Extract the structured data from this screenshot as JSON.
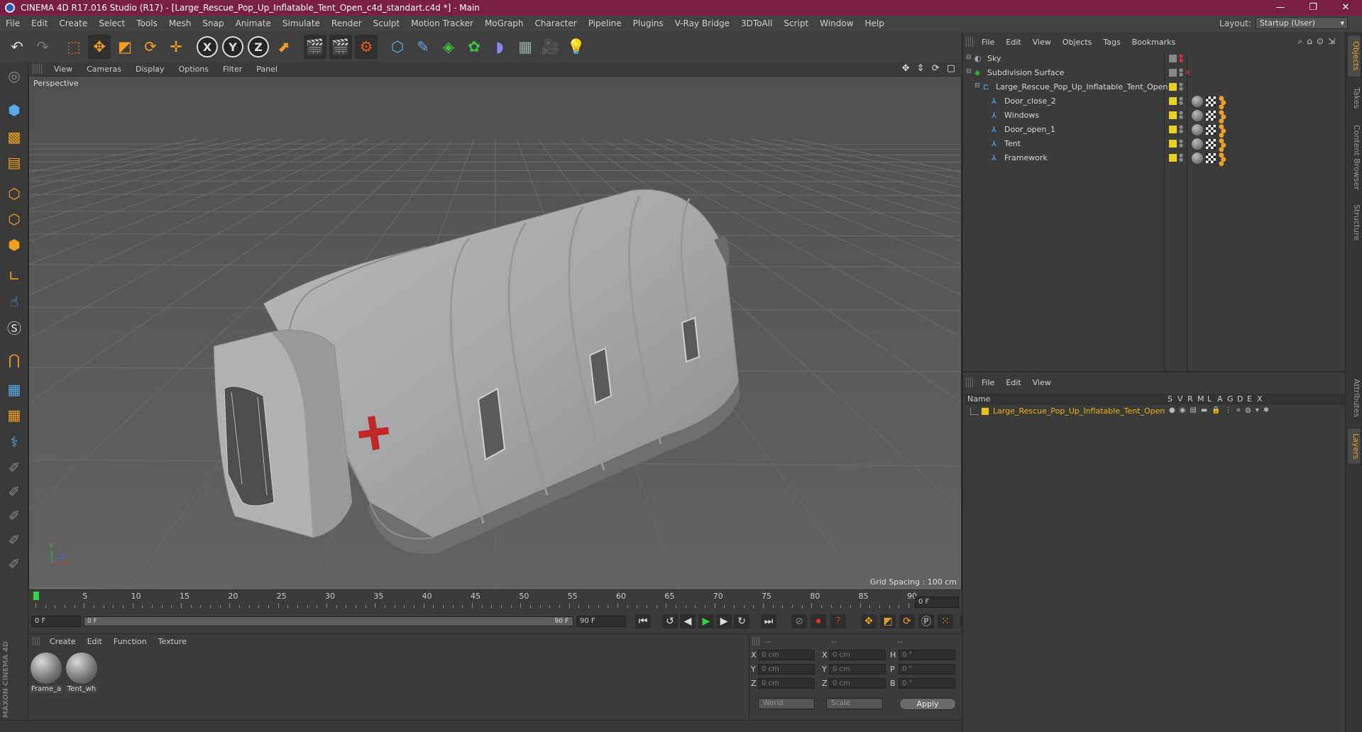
{
  "window": {
    "title": "CINEMA 4D R17.016 Studio (R17) - [Large_Rescue_Pop_Up_Inflatable_Tent_Open_c4d_standart.c4d *] - Main",
    "controls": [
      "—",
      "❐",
      "✕"
    ]
  },
  "menubar": {
    "items": [
      "File",
      "Edit",
      "Create",
      "Select",
      "Tools",
      "Mesh",
      "Snap",
      "Animate",
      "Simulate",
      "Render",
      "Sculpt",
      "Motion Tracker",
      "MoGraph",
      "Character",
      "Pipeline",
      "Plugins",
      "V-Ray Bridge",
      "3DToAll",
      "Script",
      "Window",
      "Help"
    ],
    "layout_label": "Layout:",
    "layout_value": "Startup (User)"
  },
  "viewport": {
    "menu": [
      "View",
      "Cameras",
      "Display",
      "Options",
      "Filter",
      "Panel"
    ],
    "controls": "✥ ⇕ ⟳ ▢",
    "label": "Perspective",
    "grid_spacing": "Grid Spacing : 100 cm",
    "axis_labels": [
      "Y",
      "Z",
      "X"
    ]
  },
  "timeline": {
    "ticks": [
      "0",
      "5",
      "10",
      "15",
      "20",
      "25",
      "30",
      "35",
      "40",
      "45",
      "50",
      "55",
      "60",
      "65",
      "70",
      "75",
      "80",
      "85",
      "90"
    ],
    "current_frame": "0 F"
  },
  "transport": {
    "start_field": "0 F",
    "slider_start": "0 F",
    "slider_end": "90 F",
    "end_field": "90 F"
  },
  "materials": {
    "menu": [
      "Create",
      "Edit",
      "Function",
      "Texture"
    ],
    "items": [
      "Frame_a",
      "Tent_wh"
    ]
  },
  "coordinates": {
    "headers": [
      "--",
      "--",
      "--"
    ],
    "rows": [
      {
        "a": "X",
        "v1": "0 cm",
        "b": "X",
        "v2": "0 cm",
        "c": "H",
        "v3": "0 °"
      },
      {
        "a": "Y",
        "v1": "0 cm",
        "b": "Y",
        "v2": "0 cm",
        "c": "P",
        "v3": "0 °"
      },
      {
        "a": "Z",
        "v1": "0 cm",
        "b": "Z",
        "v2": "0 cm",
        "c": "B",
        "v3": "0 °"
      }
    ],
    "mode1": "World",
    "mode2": "Scale",
    "apply": "Apply"
  },
  "object_manager": {
    "menu": [
      "File",
      "Edit",
      "View",
      "Objects",
      "Tags",
      "Bookmarks"
    ],
    "objects": [
      {
        "name": "Sky",
        "indent": 0,
        "color": "#888888",
        "tags": false
      },
      {
        "name": "Subdivision Surface",
        "indent": 0,
        "color": "#888888",
        "tags": false
      },
      {
        "name": "Large_Rescue_Pop_Up_Inflatable_Tent_Open",
        "indent": 1,
        "color": "#e8d020",
        "tags": false
      },
      {
        "name": "Door_close_2",
        "indent": 2,
        "color": "#e8d020",
        "tags": true
      },
      {
        "name": "Windows",
        "indent": 2,
        "color": "#e8d020",
        "tags": true
      },
      {
        "name": "Door_open_1",
        "indent": 2,
        "color": "#e8d020",
        "tags": true
      },
      {
        "name": "Tent",
        "indent": 2,
        "color": "#e8d020",
        "tags": true
      },
      {
        "name": "Framework",
        "indent": 2,
        "color": "#e8d020",
        "tags": true
      }
    ]
  },
  "layer_manager": {
    "menu": [
      "File",
      "Edit",
      "View"
    ],
    "columns": [
      "Name",
      "S",
      "V",
      "R",
      "M",
      "L",
      "A",
      "G",
      "D",
      "E",
      "X"
    ],
    "layers": [
      {
        "name": "Large_Rescue_Pop_Up_Inflatable_Tent_Open",
        "color": "#e8c020"
      }
    ]
  },
  "right_tabs": [
    "Objects",
    "Takes",
    "Content Browser",
    "Structure",
    "Attributes",
    "Layers"
  ],
  "branding": "MAXON CINEMA 4D"
}
